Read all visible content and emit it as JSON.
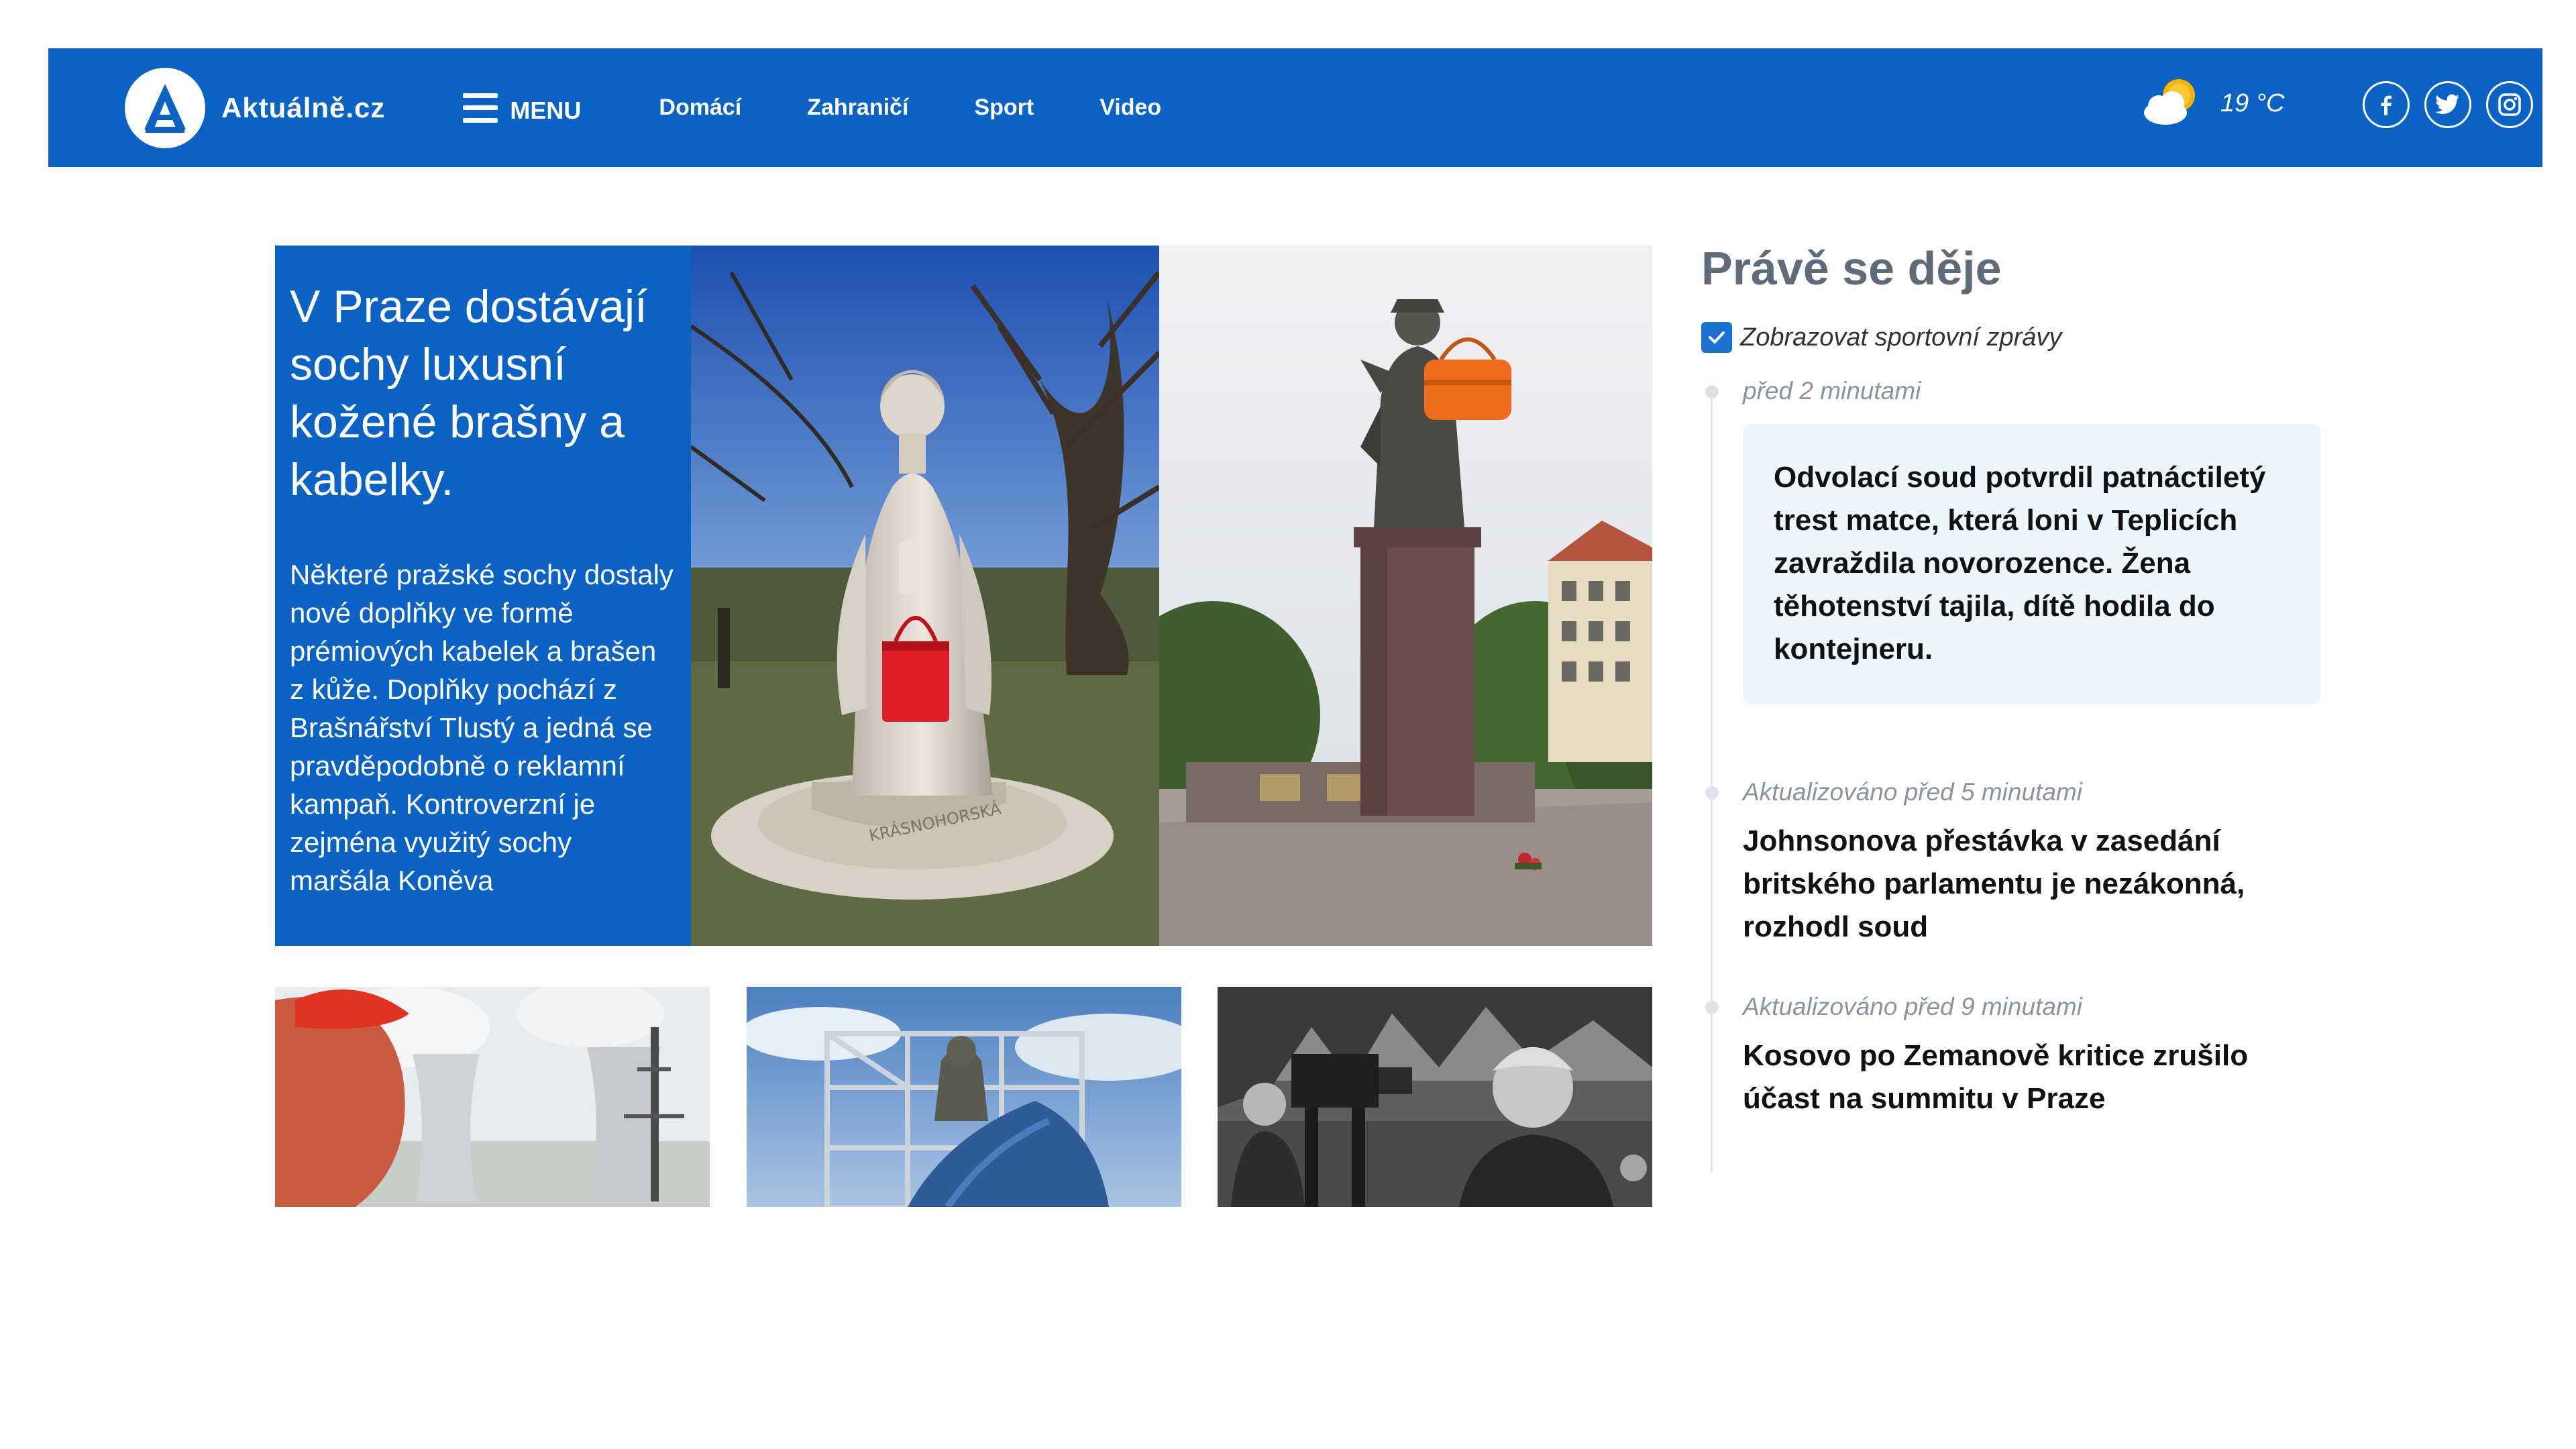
{
  "header": {
    "logo_text": "Aktuálně.cz",
    "menu_label": "MENU",
    "nav": [
      {
        "label": "Domácí"
      },
      {
        "label": "Zahraničí"
      },
      {
        "label": "Sport"
      },
      {
        "label": "Video"
      }
    ],
    "weather": {
      "icon": "partly-cloudy-icon",
      "temperature": "19 °C"
    },
    "social_icons": [
      "facebook-icon",
      "twitter-icon",
      "instagram-icon"
    ],
    "accent_color": "#0a63c4"
  },
  "hero": {
    "title": "V Praze dostávají sochy luxusní kožené brašny a kabelky.",
    "perex": "Některé pražské sochy dostaly nové doplňky ve formě prémiových kabelek a brašen z kůže. Doplňky pochází z Brašnářství Tlustý a jedná se pravděpodobně o reklamní kampaň. Kontroverzní je zejména využitý sochy maršála Koněva",
    "statue_plinth_text": "KRÁSNOHORSKÁ"
  },
  "live": {
    "title": "Právě se děje",
    "sport_toggle_label": "Zobrazovat sportovní zprávy",
    "sport_toggle_checked": true,
    "entries": [
      {
        "time": "před 2 minutami",
        "headline": "Odvolací soud potvrdil patnáctiletý trest matce, která loni v Teplicích zavraždila novorozence. Žena těhotenství tajila, dítě hodila do kontejneru."
      },
      {
        "time": "Aktualizováno před 5 minutami",
        "headline": "Johnsonova přestávka v zasedání britského parlamentu je nezákonná, rozhodl soud"
      },
      {
        "time": "Aktualizováno před 9 minutami",
        "headline": "Kosovo po Zemanově kritice zrušilo účast na summitu v Praze"
      }
    ]
  }
}
